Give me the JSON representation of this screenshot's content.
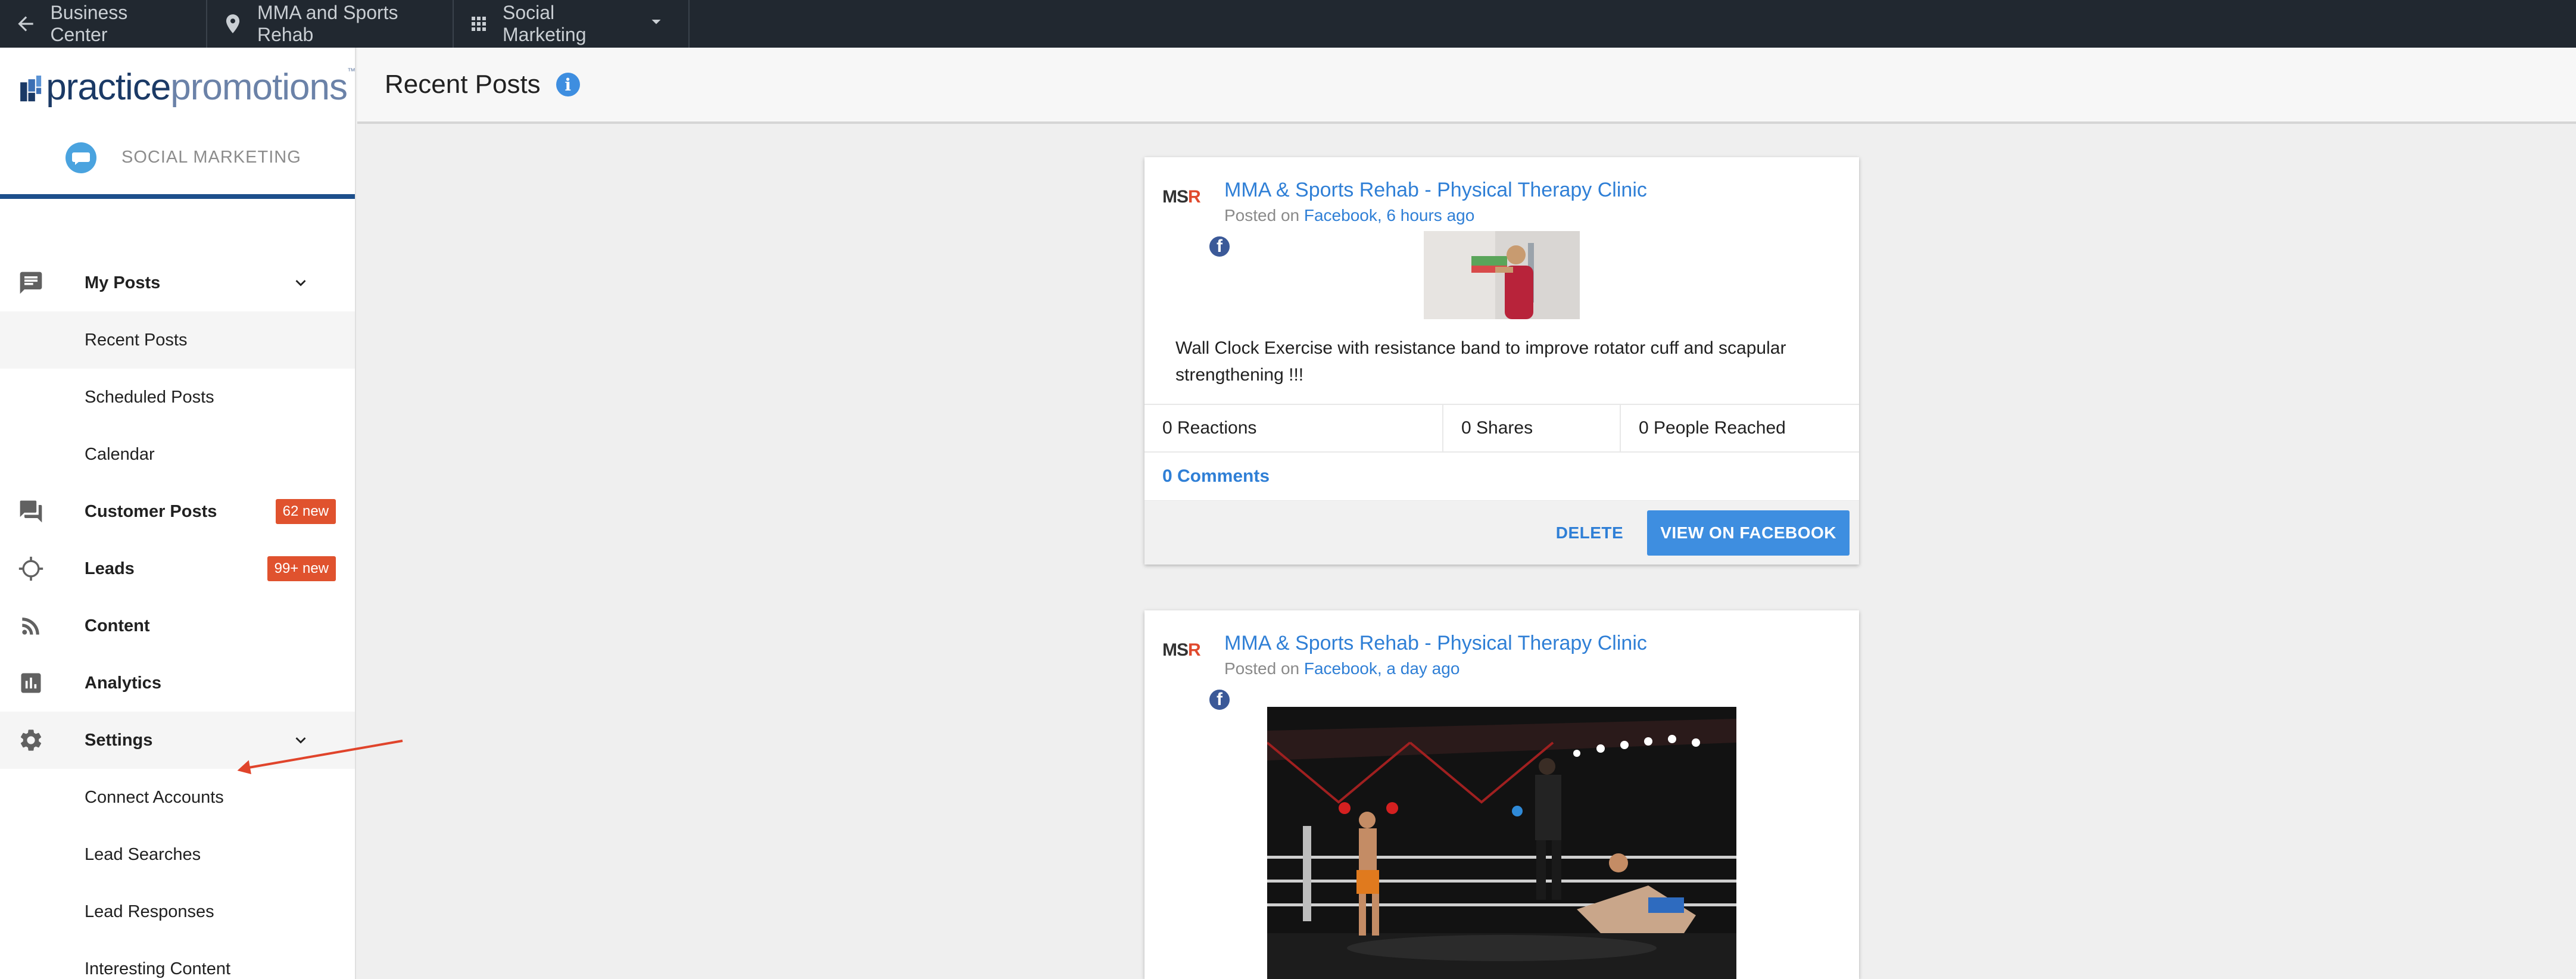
{
  "topbar": {
    "back_label": "Business Center",
    "location_label": "MMA and Sports Rehab",
    "product_label": "Social Marketing"
  },
  "sidebar": {
    "logo_part1": "practice",
    "logo_part2": "promotions",
    "logo_tm": "™",
    "app_name": "SOCIAL MARKETING",
    "items": [
      {
        "label": "My Posts",
        "icon": "chat-icon"
      },
      {
        "label": "Recent Posts"
      },
      {
        "label": "Scheduled Posts"
      },
      {
        "label": "Calendar"
      },
      {
        "label": "Customer Posts",
        "icon": "forum-icon",
        "badge": "62 new"
      },
      {
        "label": "Leads",
        "icon": "crosshair-icon",
        "badge": "99+ new"
      },
      {
        "label": "Content",
        "icon": "rss-icon"
      },
      {
        "label": "Analytics",
        "icon": "bar-chart-icon"
      },
      {
        "label": "Settings",
        "icon": "gear-icon"
      },
      {
        "label": "Connect Accounts"
      },
      {
        "label": "Lead Searches"
      },
      {
        "label": "Lead Responses"
      },
      {
        "label": "Interesting Content"
      }
    ]
  },
  "main": {
    "title": "Recent Posts",
    "info_glyph": "i",
    "posts": [
      {
        "page_name": "MMA & Sports Rehab - Physical Therapy Clinic",
        "posted_prefix": "Posted on ",
        "posted_link": "Facebook, 6 hours ago",
        "text": "Wall Clock Exercise with resistance band to improve rotator cuff and scapular strengthening !!!",
        "reactions": "0 Reactions",
        "shares": "0 Shares",
        "reached": "0 People Reached",
        "comments": "0 Comments",
        "delete_label": "DELETE",
        "view_label": "VIEW ON FACEBOOK"
      },
      {
        "page_name": "MMA & Sports Rehab - Physical Therapy Clinic",
        "posted_prefix": "Posted on ",
        "posted_link": "Facebook, a day ago"
      }
    ],
    "avatar_text_a": "MS",
    "avatar_text_b": "R",
    "fb_glyph": "f"
  },
  "colors": {
    "accent": "#3e8ee0",
    "topbar_bg": "#212830",
    "badge": "#e0522e",
    "annotation_arrow": "#e0442b"
  }
}
